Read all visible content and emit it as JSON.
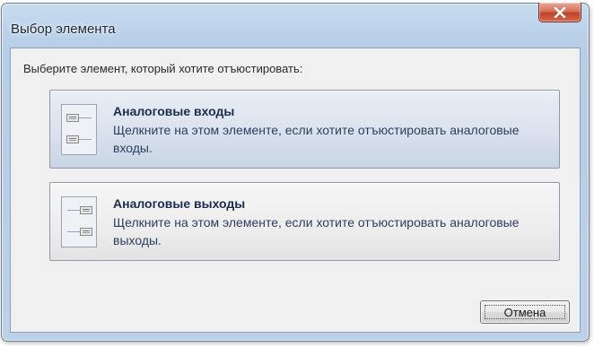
{
  "window": {
    "title": "Выбор элемента",
    "close_icon": "close-x-icon"
  },
  "dialog": {
    "prompt": "Выберите элемент, который хотите отъюстировать:",
    "options": [
      {
        "title": "Аналоговые входы",
        "description": "Щелкните на этом элементе, если хотите отъюстировать аналоговые входы.",
        "icon": "analog-inputs-icon",
        "state": "hover"
      },
      {
        "title": "Аналоговые выходы",
        "description": "Щелкните на этом элементе, если хотите отъюстировать аналоговые выходы.",
        "icon": "analog-outputs-icon",
        "state": "normal"
      }
    ],
    "cancel_label": "Отмена"
  },
  "colors": {
    "title_bar": "#bcd2ea",
    "close_button": "#c2412a",
    "option_title": "#1b2d4d"
  }
}
